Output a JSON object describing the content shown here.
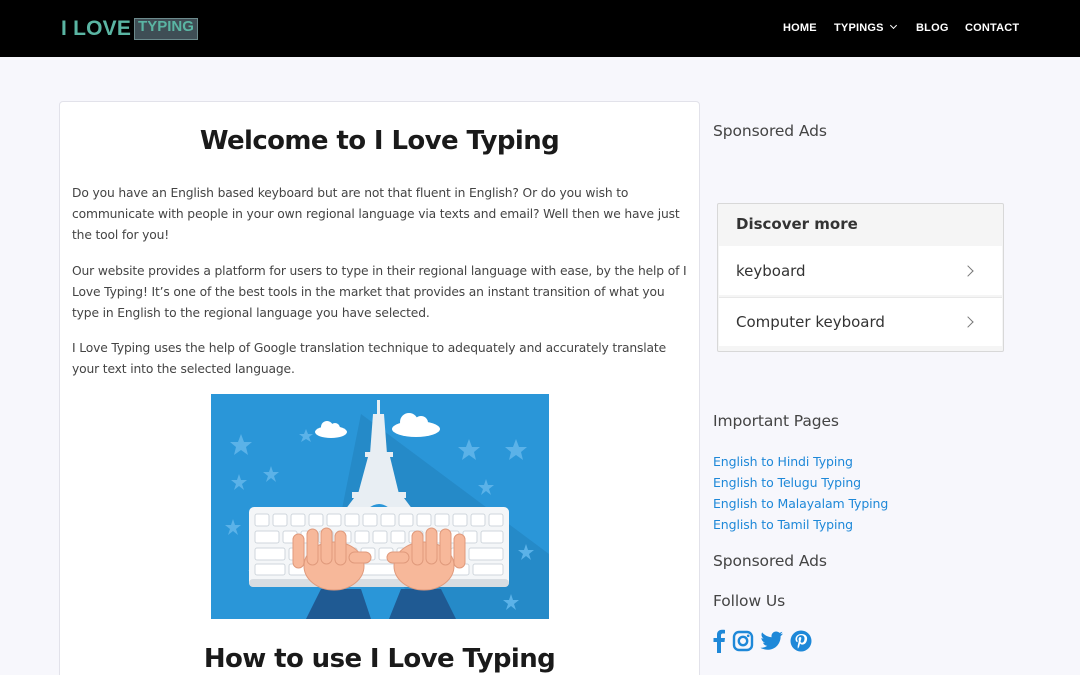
{
  "header": {
    "logo_main": "I LOVE",
    "logo_box": "TYPING",
    "logo_sub": "• • • • • • • • • •",
    "nav": {
      "home": "HOME",
      "typings": "TYPINGS",
      "blog": "BLOG",
      "contact": "CONTACT"
    }
  },
  "main": {
    "title": "Welcome to I Love Typing",
    "paragraphs": [
      "Do you have an English based keyboard but are not that fluent in English? Or do you wish to communicate with people in your own regional language via texts and email? Well then we have just the tool for you!",
      "Our website provides a platform for users to type in their regional language with ease, by the help of I Love Typing! It’s one of the best tools in the market that provides an instant transition of what you type in English to the regional language you have selected.",
      "I Love Typing uses the help of Google translation technique to adequately and accurately translate your text into the selected language."
    ],
    "subtitle": "How to use I Love Typing"
  },
  "sidebar": {
    "sponsored_top": "Sponsored Ads",
    "discover": {
      "title": "Discover more",
      "items": [
        "keyboard",
        "Computer keyboard"
      ]
    },
    "important_pages": {
      "title": "Important Pages",
      "links": [
        "English to Hindi Typing",
        "English to Telugu Typing",
        "English to Malayalam Typing",
        "English to Tamil Typing"
      ]
    },
    "sponsored_bottom": "Sponsored Ads",
    "follow_us": "Follow Us",
    "social_icons": [
      "facebook-icon",
      "instagram-icon",
      "twitter-icon",
      "pinterest-icon"
    ]
  },
  "colors": {
    "header_bg": "#000000",
    "logo_teal": "#5ab5a3",
    "link_blue": "#1e88d8",
    "hero_bg": "#2a96d8"
  }
}
